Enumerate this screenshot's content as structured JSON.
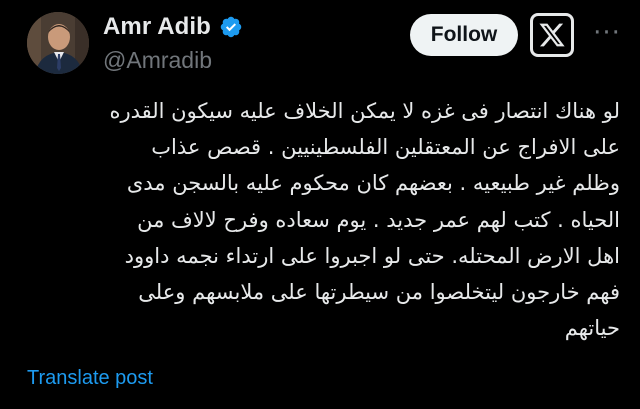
{
  "author": {
    "display_name": "Amr Adib",
    "handle": "@Amradib",
    "verified": true
  },
  "actions": {
    "follow_label": "Follow",
    "more_label": "···"
  },
  "post": {
    "text": "لو هناك انتصار فى غزه لا يمكن الخلاف عليه سيكون القدره\nعلى الافراج عن المعتقلين الفلسطينيين . قصص عذاب\nوظلم غير طبيعيه . بعضهم كان محكوم عليه بالسجن مدى\nالحياه . كتب لهم عمر جديد . يوم سعاده وفرح لالاف من\nاهل الارض المحتله. حتى لو اجبروا على ارتداء نجمه داوود\nفهم خارجون ليتخلصوا من سيطرتها على ملابسهم وعلى\nحياتهم",
    "translate_label": "Translate post"
  },
  "icons": {
    "verified": "verified-badge-icon",
    "brand": "x-logo-icon",
    "more": "more-options-icon"
  },
  "colors": {
    "background": "#000000",
    "text_primary": "#e7e9ea",
    "text_secondary": "#71767b",
    "link": "#1d9bf0",
    "verified": "#1d9bf0",
    "follow_bg": "#eff3f4"
  }
}
